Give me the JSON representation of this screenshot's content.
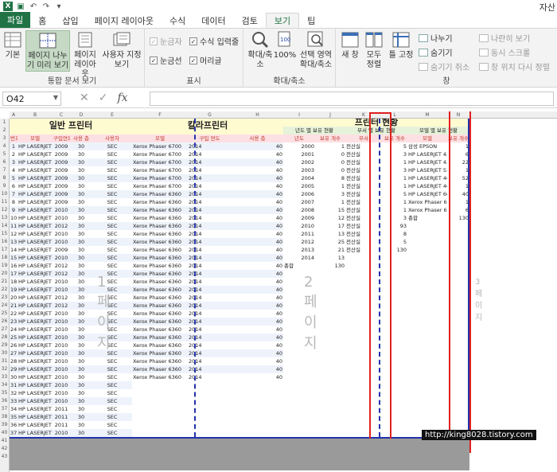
{
  "app": {
    "title": "자산"
  },
  "tabs": [
    "파일",
    "홈",
    "삽입",
    "페이지 레이아웃",
    "수식",
    "데이터",
    "검토",
    "보기",
    "팁"
  ],
  "active_tab": "보기",
  "ribbon": {
    "workbook_views": {
      "label": "통합 문서 보기",
      "normal": "기본",
      "page_break": "페이지 나누기 미리 보기",
      "page_layout": "페이지 레이아웃",
      "custom": "사용자 지정 보기"
    },
    "show": {
      "label": "표시",
      "ruler": "눈금자",
      "formula_bar": "수식 입력줄",
      "gridlines": "눈금선",
      "headings": "머리글"
    },
    "zoom": {
      "label": "확대/축소",
      "zoom": "확대/축소",
      "zoom100": "100%",
      "zoom_selection": "선택 영역 확대/축소"
    },
    "window": {
      "label": "창",
      "new_window": "새 창",
      "arrange": "모두 정렬",
      "freeze": "틀 고정",
      "split": "나누기",
      "hide": "숨기기",
      "unhide": "숨기기 취소",
      "side_by_side": "나란히 보기",
      "sync_scroll": "동시 스크롤",
      "reset_pos": "창 위치 다시 정렬"
    }
  },
  "formula_bar": {
    "name_box": "O42",
    "fx": "fx",
    "value": ""
  },
  "sheet": {
    "columns": [
      "A",
      "B",
      "C",
      "D",
      "E",
      "F",
      "G",
      "H",
      "I",
      "J",
      "K",
      "L",
      "M",
      "N"
    ],
    "rows": [
      "1",
      "2",
      "3",
      "4",
      "5",
      "6",
      "7",
      "8",
      "9",
      "10",
      "11",
      "12",
      "13",
      "14",
      "15",
      "16",
      "17",
      "18",
      "19",
      "20",
      "21",
      "22",
      "23",
      "24",
      "25",
      "26",
      "27",
      "28",
      "29",
      "30",
      "31",
      "32",
      "33",
      "34",
      "35",
      "36",
      "37",
      "38",
      "39",
      "40",
      "41",
      "42",
      "43"
    ],
    "titles": {
      "general": "일반 프린터",
      "color": "칼라프린터",
      "status": "프린터 현황"
    },
    "header_general": [
      "번호",
      "모델",
      "구입연도",
      "사용 층",
      "사용자"
    ],
    "header_color": [
      "모델",
      "구입 연도",
      "사용 층"
    ],
    "sub_status1": "년도 별 보유 현황",
    "sub_status2": "부서 별 보유 현황",
    "sub_status3": "모델 별 보유 현황",
    "header_year": [
      "년도",
      "보유 개수"
    ],
    "header_dept": [
      "부서",
      "보유 개수"
    ],
    "header_model": [
      "모델",
      "보유 개수"
    ],
    "general_rows": [
      [
        "1",
        "HP LASERJET 4014",
        "2009",
        "30",
        "SEC"
      ],
      [
        "2",
        "HP LASERJET 4014",
        "2009",
        "30",
        "SEC"
      ],
      [
        "3",
        "HP LASERJET 4014",
        "2009",
        "30",
        "SEC"
      ],
      [
        "4",
        "HP LASERJET 4014",
        "2009",
        "30",
        "SEC"
      ],
      [
        "5",
        "HP LASERJET 4014",
        "2009",
        "30",
        "SEC"
      ],
      [
        "6",
        "HP LASERJET 4014",
        "2009",
        "30",
        "SEC"
      ],
      [
        "7",
        "HP LASERJET 4014",
        "2009",
        "30",
        "SEC"
      ],
      [
        "8",
        "HP LASERJET 4014",
        "2009",
        "30",
        "SEC"
      ],
      [
        "9",
        "HP LASERJET 4014",
        "2010",
        "30",
        "SEC"
      ],
      [
        "10",
        "HP LASERJET 4014",
        "2010",
        "30",
        "SEC"
      ],
      [
        "11",
        "HP LASERJET 4014",
        "2012",
        "30",
        "SEC"
      ],
      [
        "12",
        "HP LASERJET 4014",
        "2010",
        "30",
        "SEC"
      ],
      [
        "13",
        "HP LASERJET 4014",
        "2010",
        "30",
        "SEC"
      ],
      [
        "14",
        "HP LASERJET 4014",
        "2009",
        "30",
        "SEC"
      ],
      [
        "15",
        "HP LASERJET 4014",
        "2010",
        "30",
        "SEC"
      ],
      [
        "16",
        "HP LASERJET 4014",
        "2012",
        "30",
        "SEC"
      ],
      [
        "17",
        "HP LASERJET 4014",
        "2012",
        "30",
        "SEC"
      ],
      [
        "18",
        "HP LASERJET 4014",
        "2010",
        "30",
        "SEC"
      ],
      [
        "19",
        "HP LASERJET 4014",
        "2010",
        "30",
        "SEC"
      ],
      [
        "20",
        "HP LASERJET 4014",
        "2012",
        "30",
        "SEC"
      ],
      [
        "21",
        "HP LASERJET 4014",
        "2012",
        "30",
        "SEC"
      ],
      [
        "22",
        "HP LASERJET 4014",
        "2010",
        "30",
        "SEC"
      ],
      [
        "23",
        "HP LASERJET 4014",
        "2010",
        "30",
        "SEC"
      ],
      [
        "24",
        "HP LASERJET 4014",
        "2010",
        "30",
        "SEC"
      ],
      [
        "25",
        "HP LASERJET 4014",
        "2010",
        "30",
        "SEC"
      ],
      [
        "26",
        "HP LASERJET 4014",
        "2010",
        "30",
        "SEC"
      ],
      [
        "27",
        "HP LASERJET 4014",
        "2010",
        "30",
        "SEC"
      ],
      [
        "28",
        "HP LASERJET 4014",
        "2010",
        "30",
        "SEC"
      ],
      [
        "29",
        "HP LASERJET 4014",
        "2010",
        "30",
        "SEC"
      ],
      [
        "30",
        "HP LASERJET 4014",
        "2010",
        "30",
        "SEC"
      ],
      [
        "31",
        "HP LASERJET 4014",
        "2010",
        "30",
        "SEC"
      ],
      [
        "32",
        "HP LASERJET 4014",
        "2010",
        "30",
        "SEC"
      ],
      [
        "33",
        "HP LASERJET 4014",
        "2010",
        "30",
        "SEC"
      ],
      [
        "34",
        "HP LASERJET 4014",
        "2011",
        "30",
        "SEC"
      ],
      [
        "35",
        "HP LASERJET 4014",
        "2011",
        "30",
        "SEC"
      ],
      [
        "36",
        "HP LASERJET 4014",
        "2011",
        "30",
        "SEC"
      ],
      [
        "37",
        "HP LASERJET 4014",
        "2010",
        "30",
        "SEC"
      ],
      [
        "38",
        "HP LASERJET 4014",
        "2011",
        "30",
        "SEC"
      ]
    ],
    "color_rows": [
      [
        "Xerox Phaser 6700",
        "2014",
        "40"
      ],
      [
        "Xerox Phaser 6700",
        "2014",
        "40"
      ],
      [
        "Xerox Phaser 6700",
        "2014",
        "40"
      ],
      [
        "Xerox Phaser 6700",
        "2014",
        "40"
      ],
      [
        "Xerox Phaser 6700",
        "2014",
        "40"
      ],
      [
        "Xerox Phaser 6700",
        "2014",
        "40"
      ],
      [
        "Xerox Phaser 6360",
        "2014",
        "40"
      ],
      [
        "Xerox Phaser 6360",
        "2014",
        "40"
      ],
      [
        "Xerox Phaser 6360",
        "2014",
        "40"
      ],
      [
        "Xerox Phaser 6360",
        "2014",
        "40"
      ],
      [
        "Xerox Phaser 6360",
        "2014",
        "40"
      ],
      [
        "Xerox Phaser 6360",
        "2014",
        "40"
      ],
      [
        "Xerox Phaser 6360",
        "2014",
        "40"
      ],
      [
        "Xerox Phaser 6360",
        "2014",
        "40"
      ],
      [
        "Xerox Phaser 6360",
        "2014",
        "40"
      ],
      [
        "Xerox Phaser 6360",
        "2014",
        "40"
      ],
      [
        "Xerox Phaser 6360",
        "2014",
        "40"
      ],
      [
        "Xerox Phaser 6360",
        "2014",
        "40"
      ],
      [
        "Xerox Phaser 6360",
        "2014",
        "40"
      ],
      [
        "Xerox Phaser 6360",
        "2014",
        "40"
      ],
      [
        "Xerox Phaser 6360",
        "2014",
        "40"
      ],
      [
        "Xerox Phaser 6360",
        "2014",
        "40"
      ],
      [
        "Xerox Phaser 6360",
        "2014",
        "40"
      ],
      [
        "Xerox Phaser 6360",
        "2014",
        "40"
      ],
      [
        "Xerox Phaser 6360",
        "2014",
        "40"
      ],
      [
        "Xerox Phaser 6360",
        "2014",
        "40"
      ],
      [
        "Xerox Phaser 6360",
        "2014",
        "40"
      ],
      [
        "Xerox Phaser 6360",
        "2014",
        "40"
      ],
      [
        "Xerox Phaser 6360",
        "2014",
        "40"
      ],
      [
        "Xerox Phaser 6360",
        "2014",
        "40"
      ]
    ],
    "year_rows": [
      [
        "2000",
        "1"
      ],
      [
        "2001",
        "0"
      ],
      [
        "2002",
        "0"
      ],
      [
        "2003",
        "0"
      ],
      [
        "2004",
        "8"
      ],
      [
        "2005",
        "1"
      ],
      [
        "2006",
        "3"
      ],
      [
        "2007",
        "1"
      ],
      [
        "2008",
        "15"
      ],
      [
        "2009",
        "12"
      ],
      [
        "2010",
        "17"
      ],
      [
        "2011",
        "13"
      ],
      [
        "2012",
        "25"
      ],
      [
        "2013",
        "21"
      ],
      [
        "2014",
        "13"
      ]
    ],
    "year_total": [
      "총합",
      "130"
    ],
    "dept_rows": [
      [
        "전산실",
        "5"
      ],
      [
        "전산실",
        "3"
      ],
      [
        "전산실",
        "1"
      ],
      [
        "전산실",
        "3"
      ],
      [
        "전산실",
        "1"
      ],
      [
        "전산실",
        "1"
      ],
      [
        "전산실",
        "5"
      ],
      [
        "전산실",
        "1"
      ],
      [
        "전산실",
        "1"
      ],
      [
        "전산실",
        "3"
      ],
      [
        "전산실",
        "93"
      ],
      [
        "전산실",
        "8"
      ],
      [
        "전산실",
        "5"
      ],
      [
        "전산실",
        "130"
      ]
    ],
    "model_rows": [
      [
        "삼성 EPSON",
        "1"
      ],
      [
        "HP LASERJET 420",
        "6"
      ],
      [
        "HP LASERJET 425",
        "22"
      ],
      [
        "HP LASERJET 520",
        "1"
      ],
      [
        "HP LASERJET 401",
        "52"
      ],
      [
        "HP LASERJET 401",
        "1"
      ],
      [
        "HP LASERJET 600",
        "40"
      ],
      [
        "Xerox Phaser 6360",
        "1"
      ],
      [
        "Xerox Phaser 6700",
        "6"
      ],
      [
        "총합",
        "130"
      ]
    ],
    "page_watermarks": [
      "1 페이지",
      "2 페이지",
      "3 페이지"
    ],
    "url": "http://king8028.tistory.com"
  }
}
